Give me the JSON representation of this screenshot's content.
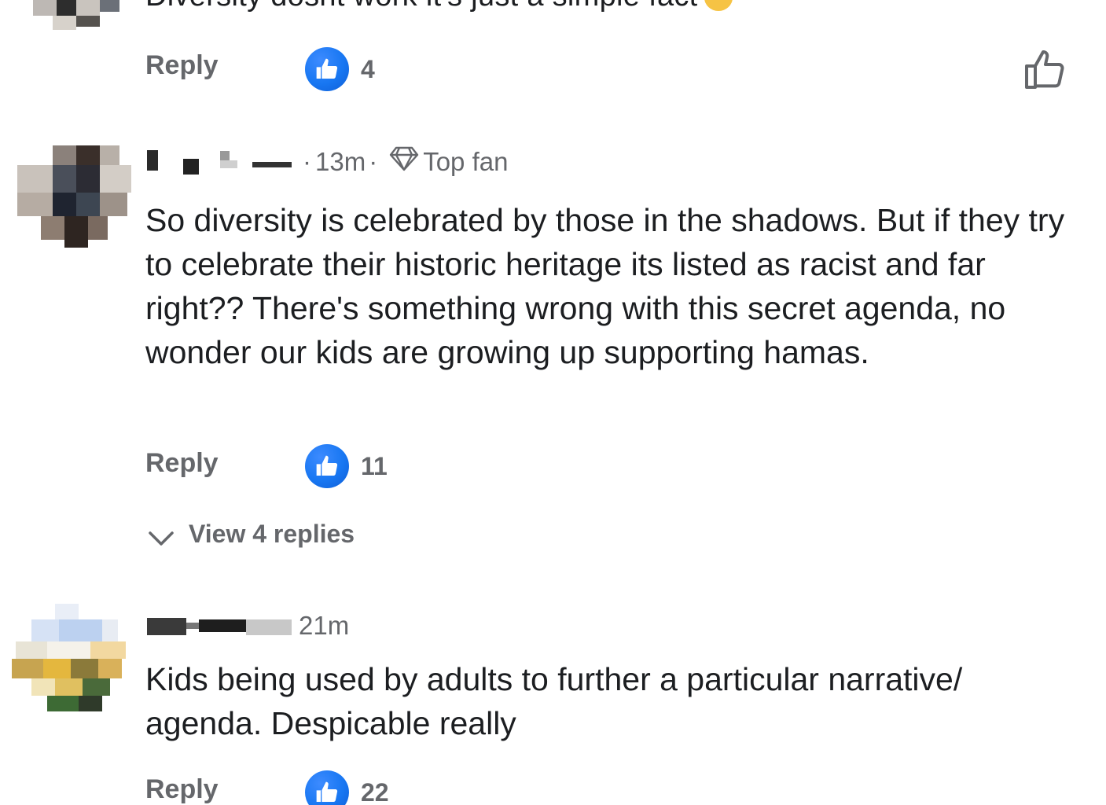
{
  "comments": [
    {
      "text_partial": "Diversity dosnt work it's just a simple fact",
      "reply_label": "Reply",
      "likes": "4"
    },
    {
      "time": "13m",
      "separator": "·",
      "badge": "Top fan",
      "text": "So diversity is celebrated by those in the shadows. But if they try to celebrate their historic heritage its listed as racist and far right?? There's something wrong with this secret agenda, no wonder our kids are growing up supporting hamas.",
      "reply_label": "Reply",
      "likes": "11",
      "view_replies": "View 4 replies"
    },
    {
      "time": "21m",
      "text": "Kids being used by adults to further a particular narrative/ agenda. Despicable really",
      "reply_label": "Reply",
      "likes": "22"
    }
  ],
  "colors": {
    "like_blue": "#1877f2",
    "secondary_text": "#65676b",
    "primary_text": "#1c1e21"
  },
  "icons": [
    "thumbs-up-icon",
    "thumbs-up-outline-icon",
    "diamond-icon",
    "chevron-down-icon",
    "ok-hand-emoji"
  ]
}
